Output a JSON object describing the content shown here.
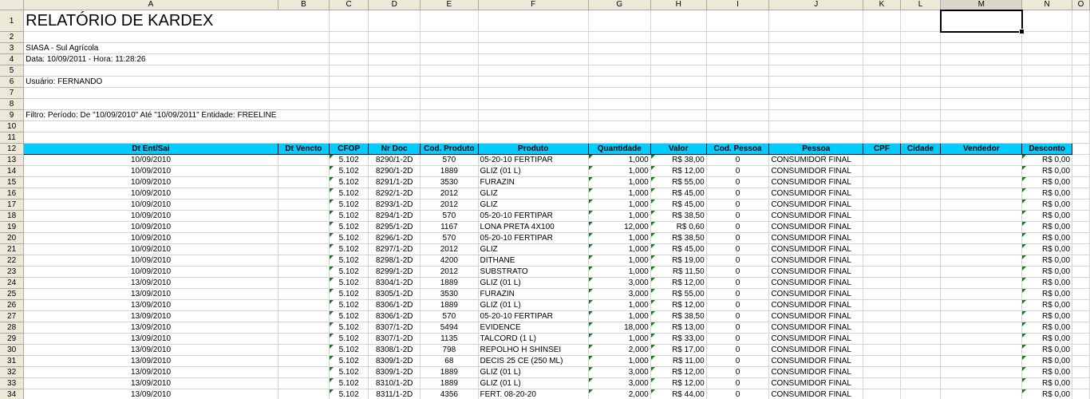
{
  "columns": [
    "A",
    "B",
    "C",
    "D",
    "E",
    "F",
    "G",
    "H",
    "I",
    "J",
    "K",
    "L",
    "M",
    "N",
    "O"
  ],
  "rows_before": [
    {
      "num": "1",
      "text": "RELATÓRIO DE KARDEX",
      "kind": "title"
    },
    {
      "num": "2",
      "text": ""
    },
    {
      "num": "3",
      "text": "SIASA - Sul Agrícola"
    },
    {
      "num": "4",
      "text": "Data: 10/09/2011 - Hora: 11:28:26"
    },
    {
      "num": "5",
      "text": ""
    },
    {
      "num": "6",
      "text": "Usuário: FERNANDO"
    },
    {
      "num": "7",
      "text": ""
    },
    {
      "num": "8",
      "text": ""
    },
    {
      "num": "9",
      "text": "Filtro: Período: De \"10/09/2010\" Até \"10/09/2011\" Entidade: FREELINE"
    },
    {
      "num": "10",
      "text": ""
    },
    {
      "num": "11",
      "text": ""
    }
  ],
  "header_row": {
    "num": "12",
    "labels": [
      "Dt Ent/Sai",
      "Dt Vencto",
      "CFOP",
      "Nr Doc",
      "Cod. Produto",
      "Produto",
      "Quantidade",
      "Valor",
      "Cod. Pessoa",
      "Pessoa",
      "CPF",
      "Cidade",
      "Vendedor",
      "Desconto"
    ]
  },
  "data_rows": [
    {
      "num": "13",
      "cells": [
        "10/09/2010",
        "",
        "5.102",
        "8290/1-2D",
        "570",
        "05-20-10 FERTIPAR",
        "1,000",
        "R$ 38,00",
        "0",
        "CONSUMIDOR FINAL",
        "",
        "",
        "",
        "R$ 0,00"
      ]
    },
    {
      "num": "14",
      "cells": [
        "10/09/2010",
        "",
        "5.102",
        "8290/1-2D",
        "1889",
        "GLIZ (01 L)",
        "1,000",
        "R$ 12,00",
        "0",
        "CONSUMIDOR FINAL",
        "",
        "",
        "",
        "R$ 0,00"
      ]
    },
    {
      "num": "15",
      "cells": [
        "10/09/2010",
        "",
        "5.102",
        "8291/1-2D",
        "3530",
        "FURAZIN",
        "1,000",
        "R$ 55,00",
        "0",
        "CONSUMIDOR FINAL",
        "",
        "",
        "",
        "R$ 0,00"
      ]
    },
    {
      "num": "16",
      "cells": [
        "10/09/2010",
        "",
        "5.102",
        "8292/1-2D",
        "2012",
        "GLIZ",
        "1,000",
        "R$ 45,00",
        "0",
        "CONSUMIDOR FINAL",
        "",
        "",
        "",
        "R$ 0,00"
      ]
    },
    {
      "num": "17",
      "cells": [
        "10/09/2010",
        "",
        "5.102",
        "8293/1-2D",
        "2012",
        "GLIZ",
        "1,000",
        "R$ 45,00",
        "0",
        "CONSUMIDOR FINAL",
        "",
        "",
        "",
        "R$ 0,00"
      ]
    },
    {
      "num": "18",
      "cells": [
        "10/09/2010",
        "",
        "5.102",
        "8294/1-2D",
        "570",
        "05-20-10 FERTIPAR",
        "1,000",
        "R$ 38,50",
        "0",
        "CONSUMIDOR FINAL",
        "",
        "",
        "",
        "R$ 0,00"
      ]
    },
    {
      "num": "19",
      "cells": [
        "10/09/2010",
        "",
        "5.102",
        "8295/1-2D",
        "1167",
        "LONA PRETA 4X100",
        "12,000",
        "R$ 0,60",
        "0",
        "CONSUMIDOR FINAL",
        "",
        "",
        "",
        "R$ 0,00"
      ]
    },
    {
      "num": "20",
      "cells": [
        "10/09/2010",
        "",
        "5.102",
        "8296/1-2D",
        "570",
        "05-20-10 FERTIPAR",
        "1,000",
        "R$ 38,50",
        "0",
        "CONSUMIDOR FINAL",
        "",
        "",
        "",
        "R$ 0,00"
      ]
    },
    {
      "num": "21",
      "cells": [
        "10/09/2010",
        "",
        "5.102",
        "8297/1-2D",
        "2012",
        "GLIZ",
        "1,000",
        "R$ 45,00",
        "0",
        "CONSUMIDOR FINAL",
        "",
        "",
        "",
        "R$ 0,00"
      ]
    },
    {
      "num": "22",
      "cells": [
        "10/09/2010",
        "",
        "5.102",
        "8298/1-2D",
        "4200",
        "DITHANE",
        "1,000",
        "R$ 19,00",
        "0",
        "CONSUMIDOR FINAL",
        "",
        "",
        "",
        "R$ 0,00"
      ]
    },
    {
      "num": "23",
      "cells": [
        "10/09/2010",
        "",
        "5.102",
        "8299/1-2D",
        "2012",
        "SUBSTRATO",
        "1,000",
        "R$ 11,50",
        "0",
        "CONSUMIDOR FINAL",
        "",
        "",
        "",
        "R$ 0,00"
      ]
    },
    {
      "num": "24",
      "cells": [
        "13/09/2010",
        "",
        "5.102",
        "8304/1-2D",
        "1889",
        "GLIZ (01 L)",
        "3,000",
        "R$ 12,00",
        "0",
        "CONSUMIDOR FINAL",
        "",
        "",
        "",
        "R$ 0,00"
      ]
    },
    {
      "num": "25",
      "cells": [
        "13/09/2010",
        "",
        "5.102",
        "8305/1-2D",
        "3530",
        "FURAZIN",
        "3,000",
        "R$ 55,00",
        "0",
        "CONSUMIDOR FINAL",
        "",
        "",
        "",
        "R$ 0,00"
      ]
    },
    {
      "num": "26",
      "cells": [
        "13/09/2010",
        "",
        "5.102",
        "8306/1-2D",
        "1889",
        "GLIZ (01 L)",
        "1,000",
        "R$ 12,00",
        "0",
        "CONSUMIDOR FINAL",
        "",
        "",
        "",
        "R$ 0,00"
      ]
    },
    {
      "num": "27",
      "cells": [
        "13/09/2010",
        "",
        "5.102",
        "8306/1-2D",
        "570",
        "05-20-10 FERTIPAR",
        "1,000",
        "R$ 38,50",
        "0",
        "CONSUMIDOR FINAL",
        "",
        "",
        "",
        "R$ 0,00"
      ]
    },
    {
      "num": "28",
      "cells": [
        "13/09/2010",
        "",
        "5.102",
        "8307/1-2D",
        "5494",
        "EVIDENCE",
        "18,000",
        "R$ 13,00",
        "0",
        "CONSUMIDOR FINAL",
        "",
        "",
        "",
        "R$ 0,00"
      ]
    },
    {
      "num": "29",
      "cells": [
        "13/09/2010",
        "",
        "5.102",
        "8307/1-2D",
        "1135",
        "TALCORD (1 L)",
        "1,000",
        "R$ 33,00",
        "0",
        "CONSUMIDOR FINAL",
        "",
        "",
        "",
        "R$ 0,00"
      ]
    },
    {
      "num": "30",
      "cells": [
        "13/09/2010",
        "",
        "5.102",
        "8308/1-2D",
        "798",
        "REPOLHO H SHINSEI",
        "2,000",
        "R$ 17,00",
        "0",
        "CONSUMIDOR FINAL",
        "",
        "",
        "",
        "R$ 0,00"
      ]
    },
    {
      "num": "31",
      "cells": [
        "13/09/2010",
        "",
        "5.102",
        "8309/1-2D",
        "68",
        "DECIS 25 CE (250 ML)",
        "1,000",
        "R$ 11,00",
        "0",
        "CONSUMIDOR FINAL",
        "",
        "",
        "",
        "R$ 0,00"
      ]
    },
    {
      "num": "32",
      "cells": [
        "13/09/2010",
        "",
        "5.102",
        "8309/1-2D",
        "1889",
        "GLIZ (01 L)",
        "3,000",
        "R$ 12,00",
        "0",
        "CONSUMIDOR FINAL",
        "",
        "",
        "",
        "R$ 0,00"
      ]
    },
    {
      "num": "33",
      "cells": [
        "13/09/2010",
        "",
        "5.102",
        "8310/1-2D",
        "1889",
        "GLIZ (01 L)",
        "3,000",
        "R$ 12,00",
        "0",
        "CONSUMIDOR FINAL",
        "",
        "",
        "",
        "R$ 0,00"
      ]
    },
    {
      "num": "34",
      "cells": [
        "13/09/2010",
        "",
        "5.102",
        "8311/1-2D",
        "4356",
        "FERT. 08-20-20",
        "2,000",
        "R$ 44,00",
        "0",
        "CONSUMIDOR FINAL",
        "",
        "",
        "",
        "R$ 0,00"
      ]
    }
  ],
  "colors": {
    "header_fill": "#00ccff",
    "indicator": "#1a7a1a",
    "gridline": "#d4d4d4",
    "chrome": "#ece9d8"
  }
}
